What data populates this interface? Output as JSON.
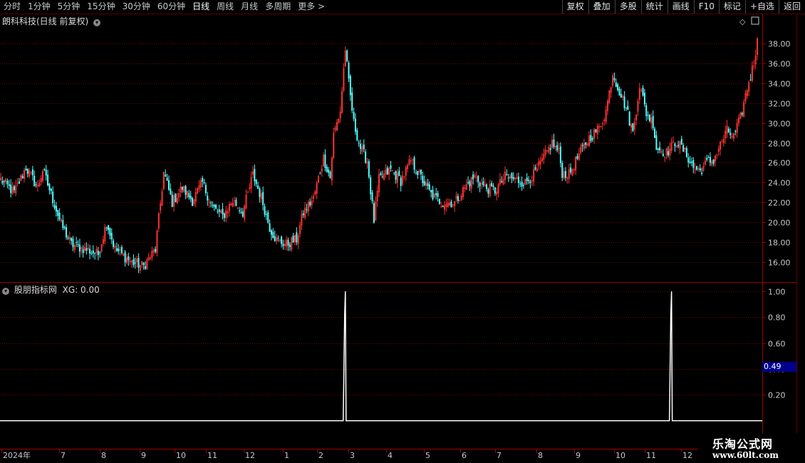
{
  "toolbar": {
    "tabs": [
      {
        "label": "分时"
      },
      {
        "label": "1分钟"
      },
      {
        "label": "5分钟"
      },
      {
        "label": "15分钟"
      },
      {
        "label": "30分钟"
      },
      {
        "label": "60分钟"
      },
      {
        "label": "日线",
        "active": true
      },
      {
        "label": "周线"
      },
      {
        "label": "月线"
      },
      {
        "label": "多周期"
      },
      {
        "label": "更多 >"
      }
    ],
    "right_buttons": [
      {
        "label": "复权"
      },
      {
        "label": "叠加"
      },
      {
        "label": "多股"
      },
      {
        "label": "统计"
      },
      {
        "label": "画线"
      },
      {
        "label": "F10"
      },
      {
        "label": "标记"
      },
      {
        "label": "+自选"
      },
      {
        "label": "返回"
      }
    ]
  },
  "stock_title": "朗科科技(日线 前复权)",
  "indicator": {
    "title": "股朋指标网",
    "xg_text": "XG: 0.00",
    "current_value": "0.49"
  },
  "watermark": {
    "line1": "乐淘公式网",
    "line2": "www.60lt.com"
  },
  "colors": {
    "up": "#ff3232",
    "down": "#54ffff",
    "grid": "#7a0000",
    "axis": "#c8c8c8",
    "signal": "#ffffff"
  },
  "chart_data": [
    {
      "type": "candlestick",
      "title": "朗科科技(日线 前复权)",
      "y_ticks": [
        16.0,
        18.0,
        20.0,
        22.0,
        24.0,
        26.0,
        28.0,
        30.0,
        32.0,
        34.0,
        36.0,
        38.0
      ],
      "ylim": [
        14.0,
        39.5
      ],
      "x_labels": [
        "2024年",
        "7",
        "8",
        "9",
        "10",
        "11",
        "12",
        "1",
        "2",
        "3",
        "4",
        "5",
        "6",
        "7",
        "8",
        "9",
        "10",
        "11",
        "12"
      ],
      "anchors": [
        [
          0,
          24.3
        ],
        [
          8,
          23.0
        ],
        [
          15,
          25.5
        ],
        [
          22,
          23.5
        ],
        [
          25,
          25.3
        ],
        [
          30,
          22.8
        ],
        [
          36,
          19.8
        ],
        [
          42,
          17.8
        ],
        [
          52,
          17.2
        ],
        [
          58,
          16.8
        ],
        [
          63,
          20.0
        ],
        [
          68,
          17.3
        ],
        [
          78,
          16.0
        ],
        [
          85,
          15.6
        ],
        [
          92,
          17.3
        ],
        [
          97,
          25.0
        ],
        [
          102,
          22.0
        ],
        [
          108,
          23.5
        ],
        [
          114,
          22.2
        ],
        [
          120,
          24.0
        ],
        [
          126,
          21.5
        ],
        [
          132,
          20.6
        ],
        [
          138,
          22.2
        ],
        [
          144,
          21.0
        ],
        [
          150,
          24.8
        ],
        [
          155,
          22.5
        ],
        [
          160,
          19.5
        ],
        [
          164,
          18.2
        ],
        [
          170,
          17.8
        ],
        [
          176,
          18.3
        ],
        [
          180,
          21.0
        ],
        [
          186,
          22.4
        ],
        [
          192,
          26.5
        ],
        [
          196,
          24.5
        ],
        [
          198,
          28.8
        ],
        [
          202,
          31.2
        ],
        [
          205,
          37.5
        ],
        [
          207,
          34.0
        ],
        [
          210,
          30.0
        ],
        [
          214,
          27.5
        ],
        [
          218,
          26.2
        ],
        [
          222,
          20.2
        ],
        [
          225,
          24.3
        ],
        [
          232,
          25.3
        ],
        [
          238,
          24.2
        ],
        [
          244,
          26.2
        ],
        [
          250,
          24.5
        ],
        [
          256,
          22.8
        ],
        [
          262,
          22.0
        ],
        [
          270,
          22.0
        ],
        [
          276,
          23.5
        ],
        [
          282,
          24.6
        ],
        [
          288,
          23.5
        ],
        [
          294,
          23.2
        ],
        [
          300,
          24.6
        ],
        [
          306,
          24.3
        ],
        [
          312,
          24.0
        ],
        [
          318,
          25.0
        ],
        [
          324,
          26.8
        ],
        [
          328,
          28.0
        ],
        [
          332,
          27.0
        ],
        [
          334,
          25.0
        ],
        [
          338,
          24.8
        ],
        [
          344,
          26.8
        ],
        [
          350,
          28.5
        ],
        [
          356,
          29.5
        ],
        [
          360,
          31.2
        ],
        [
          364,
          35.0
        ],
        [
          368,
          33.2
        ],
        [
          372,
          31.5
        ],
        [
          376,
          29.0
        ],
        [
          380,
          33.8
        ],
        [
          384,
          31.0
        ],
        [
          388,
          30.0
        ],
        [
          390,
          27.5
        ],
        [
          396,
          27.0
        ],
        [
          402,
          28.2
        ],
        [
          408,
          26.8
        ],
        [
          412,
          25.5
        ],
        [
          416,
          25.2
        ],
        [
          420,
          26.0
        ],
        [
          424,
          26.3
        ],
        [
          428,
          27.8
        ],
        [
          432,
          29.2
        ],
        [
          436,
          28.6
        ],
        [
          440,
          30.5
        ],
        [
          444,
          33.5
        ],
        [
          448,
          36.0
        ],
        [
          450,
          38.5
        ]
      ]
    },
    {
      "type": "line",
      "title": "股朋指标网",
      "series": [
        {
          "name": "XG",
          "spikes": [
            {
              "index": 205,
              "value": 1.0
            },
            {
              "index": 399,
              "value": 1.0
            }
          ]
        }
      ],
      "y_ticks": [
        0.2,
        0.4,
        0.6,
        0.8,
        1.0
      ],
      "ylim": [
        -0.2,
        1.05
      ]
    }
  ]
}
